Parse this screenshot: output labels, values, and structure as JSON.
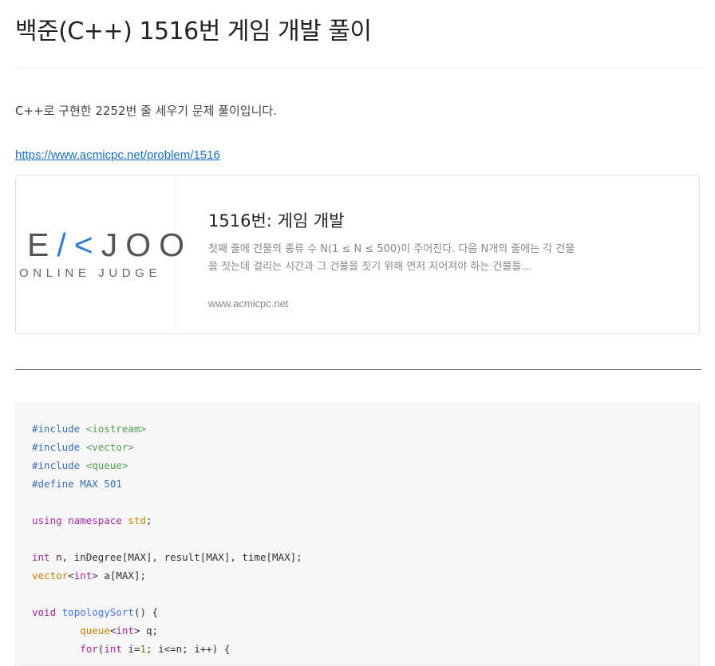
{
  "post": {
    "title": "백준(C++) 1516번 게임 개발 풀이",
    "intro": "C++로 구현한 2252번 줄 세우기 문제 풀이입니다.",
    "link": "https://www.acmicpc.net/problem/1516"
  },
  "link_card": {
    "logo_text_left": "E",
    "logo_text_accent": "/<",
    "logo_text_right": "JOO",
    "logo_subtitle": "ONLINE JUDGE",
    "title": "1516번: 게임 개발",
    "description": "첫째 줄에 건물의 종류 수 N(1 ≤ N ≤ 500)이 주어진다. 다음 N개의 줄에는 각 건물을 짓는데 걸리는 시간과 그 건물을 짓기 위해 먼저 지어져야 하는 건물들…",
    "host": "www.acmicpc.net"
  },
  "code": {
    "lines": [
      [
        {
          "t": "#include ",
          "c": "meta"
        },
        {
          "t": "<iostream>",
          "c": "str"
        }
      ],
      [
        {
          "t": "#include ",
          "c": "meta"
        },
        {
          "t": "<vector>",
          "c": "str"
        }
      ],
      [
        {
          "t": "#include ",
          "c": "meta"
        },
        {
          "t": "<queue>",
          "c": "str"
        }
      ],
      [
        {
          "t": "#define MAX 501",
          "c": "meta"
        }
      ],
      [],
      [
        {
          "t": "using",
          "c": "kw"
        },
        {
          "t": " ",
          "c": "pl"
        },
        {
          "t": "namespace",
          "c": "kw"
        },
        {
          "t": " ",
          "c": "pl"
        },
        {
          "t": "std",
          "c": "type"
        },
        {
          "t": ";",
          "c": "pl"
        }
      ],
      [],
      [
        {
          "t": "int",
          "c": "kw"
        },
        {
          "t": " n, inDegree[MAX], result[MAX], time[MAX];",
          "c": "pl"
        }
      ],
      [
        {
          "t": "vector",
          "c": "type"
        },
        {
          "t": "<",
          "c": "pl"
        },
        {
          "t": "int",
          "c": "kw"
        },
        {
          "t": "> a[MAX];",
          "c": "pl"
        }
      ],
      [],
      [
        {
          "t": "void",
          "c": "kw"
        },
        {
          "t": " ",
          "c": "pl"
        },
        {
          "t": "topologySort",
          "c": "fn"
        },
        {
          "t": "() {",
          "c": "pl"
        }
      ],
      [
        {
          "t": "        ",
          "c": "pl"
        },
        {
          "t": "queue",
          "c": "type"
        },
        {
          "t": "<",
          "c": "pl"
        },
        {
          "t": "int",
          "c": "kw"
        },
        {
          "t": "> q;",
          "c": "pl"
        }
      ],
      [
        {
          "t": "        ",
          "c": "pl"
        },
        {
          "t": "for",
          "c": "kw"
        },
        {
          "t": "(",
          "c": "pl"
        },
        {
          "t": "int",
          "c": "kw"
        },
        {
          "t": " i=",
          "c": "pl"
        },
        {
          "t": "1",
          "c": "num"
        },
        {
          "t": "; i<=n; i++) {",
          "c": "pl"
        }
      ]
    ]
  }
}
